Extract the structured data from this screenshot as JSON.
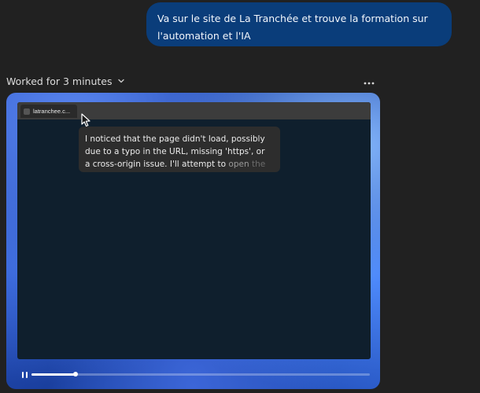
{
  "user_message": {
    "text": "Va sur le site de La Tranchée et trouve la formation sur l'automation et l'IA"
  },
  "activity": {
    "worked_label": "Worked for 3 minutes",
    "expand_icon": "chevron-down-icon",
    "more_icon": "more-horizontal-icon"
  },
  "replay": {
    "browser_tab_title": "latranchee.c...",
    "thought_text_main": "I noticed that the page didn't load, possibly due to a typo in the URL, missing 'https', or a cross-origin issue. I'll attempt to",
    "thought_text_fade1": "open",
    "thought_text_fade2": "the",
    "playback": {
      "state": "playing",
      "control_icon": "pause-icon",
      "progress": 0.13
    }
  },
  "colors": {
    "background": "#212121",
    "user_bubble": "#0a3d7a",
    "screen_background": "#0f1f2d",
    "thought_bubble": "#2d2d2d",
    "frame_accent": "#3c66d8"
  }
}
